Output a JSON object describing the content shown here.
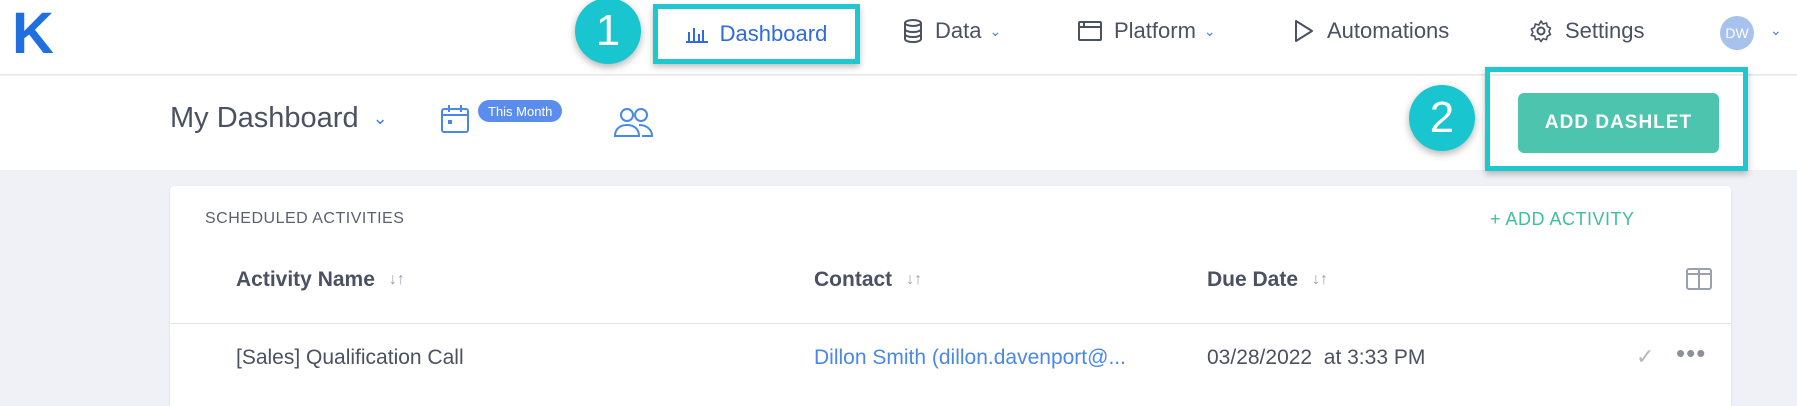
{
  "nav": {
    "logo": "K",
    "items": [
      {
        "label": "Dashboard"
      },
      {
        "label": "Data"
      },
      {
        "label": "Platform"
      },
      {
        "label": "Automations"
      },
      {
        "label": "Settings"
      }
    ],
    "avatar_initials": "DW"
  },
  "annotations": {
    "step1": "1",
    "step2": "2"
  },
  "subheader": {
    "title": "My Dashboard",
    "date_badge": "This Month",
    "add_dashlet": "ADD DASHLET"
  },
  "card": {
    "title": "SCHEDULED ACTIVITIES",
    "add_activity": "+ ADD ACTIVITY",
    "columns": [
      "Activity Name",
      "Contact",
      "Due Date"
    ],
    "rows": [
      {
        "activity": "[Sales] Qualification Call",
        "contact": "Dillon Smith (dillon.davenport@...",
        "due": "03/28/2022  at 3:33 PM"
      }
    ]
  },
  "colors": {
    "brand": "#1f6fe0",
    "highlight": "#1fc7cf",
    "accent_green": "#4dc4ad"
  }
}
